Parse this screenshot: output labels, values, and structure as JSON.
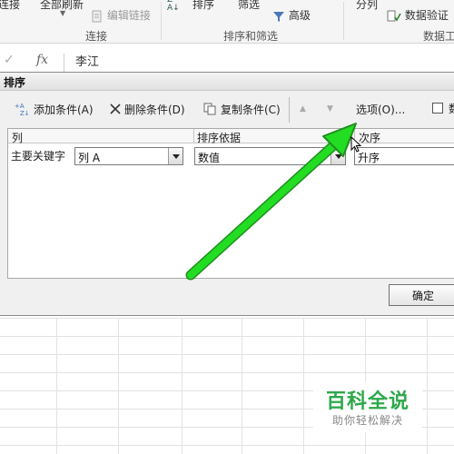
{
  "ribbon": {
    "refresh_all": "全部刷新",
    "connections_partial": "连接",
    "edit_links": "编辑链接",
    "sort": "排序",
    "filter": "筛选",
    "advanced": "高级",
    "text_to_columns": "分列",
    "data_validation": "数据验证",
    "group_connections": "连接",
    "group_sort_filter": "排序和筛选",
    "group_data_tools": "数据工"
  },
  "formula_bar": {
    "fx": "fx",
    "value": "李江"
  },
  "dialog": {
    "title": "排序",
    "toolbar": {
      "add_level": "添加条件(A)",
      "delete_level": "删除条件(D)",
      "copy_level": "复制条件(C)",
      "options": "选项(O)...",
      "header_checkbox_partial": "数"
    },
    "columns": {
      "column": "列",
      "sort_on": "排序依据",
      "order": "次序"
    },
    "row": {
      "label": "主要关键字",
      "column_value": "列 A",
      "sort_on_value": "数值",
      "order_value": "升序"
    },
    "ok": "确定"
  },
  "watermark": {
    "title": "百科全说",
    "subtitle": "助你轻松解决"
  },
  "colors": {
    "arrow": "#22dd22",
    "watermark_green": "#2ea84a"
  }
}
